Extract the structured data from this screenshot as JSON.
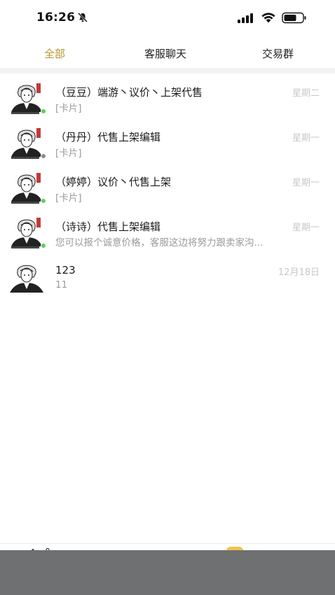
{
  "status_bar": {
    "time": "16:26"
  },
  "tabs": [
    {
      "label": "全部",
      "active": true
    },
    {
      "label": "客服聊天",
      "active": false
    },
    {
      "label": "交易群",
      "active": false
    }
  ],
  "conversations": [
    {
      "title": "（豆豆）端游丶议价丶上架代售",
      "preview": "[卡片]",
      "time": "星期二",
      "online": true
    },
    {
      "title": "（丹丹）代售上架编辑",
      "preview": "[卡片]",
      "time": "星期一",
      "online": false
    },
    {
      "title": "（婷婷）议价丶代售上架",
      "preview": "[卡片]",
      "time": "星期一",
      "online": true
    },
    {
      "title": "（诗诗）代售上架编辑",
      "preview": "您可以报个诚意价格，客服这边将努力跟卖家沟...",
      "time": "星期一",
      "online": true
    },
    {
      "title": "123",
      "preview": "11",
      "time": "12月18日",
      "online": null
    }
  ],
  "colors": {
    "accent": "#b5962e",
    "muted_text": "#9a9a9a",
    "time_text": "#c8c8c8",
    "online": "#5ad15a",
    "offline": "#8a8a8a"
  }
}
